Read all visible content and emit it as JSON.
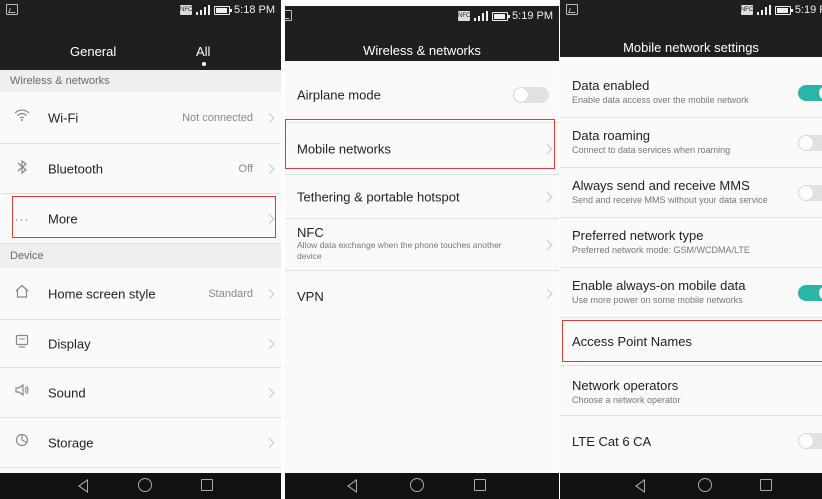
{
  "left_screen": {
    "status_time": "5:18 PM",
    "tabs": [
      {
        "label": "General"
      },
      {
        "label": "All"
      }
    ],
    "sections": [
      {
        "label": "Wireless & networks"
      },
      {
        "label": "Device"
      }
    ],
    "items": [
      {
        "label": "Wi-Fi",
        "value": "Not connected",
        "icon": "wifi-icon"
      },
      {
        "label": "Bluetooth",
        "value": "Off",
        "icon": "bluetooth-icon"
      },
      {
        "label": "More",
        "value": "",
        "icon": "more-icon"
      },
      {
        "label": "Home screen style",
        "value": "Standard",
        "icon": "home-icon"
      },
      {
        "label": "Display",
        "value": "",
        "icon": "display-icon"
      },
      {
        "label": "Sound",
        "value": "",
        "icon": "sound-icon"
      },
      {
        "label": "Storage",
        "value": "",
        "icon": "storage-icon"
      }
    ]
  },
  "middle_screen": {
    "status_time": "5:19 PM",
    "title": "Wireless & networks",
    "items": [
      {
        "label": "Airplane mode",
        "toggle": false
      },
      {
        "label": "Mobile networks"
      },
      {
        "label": "Tethering & portable hotspot"
      },
      {
        "label": "NFC",
        "subtitle": "Allow data exchange when the phone touches another device"
      },
      {
        "label": "VPN"
      }
    ]
  },
  "right_screen": {
    "status_time": "5:19 F",
    "title": "Mobile network settings",
    "items": [
      {
        "label": "Data enabled",
        "subtitle": "Enable data access over the mobile network",
        "toggle": true
      },
      {
        "label": "Data roaming",
        "subtitle": "Connect to data services when roaming",
        "toggle": false
      },
      {
        "label": "Always send and receive MMS",
        "subtitle": "Send and receive MMS without your data service",
        "toggle": false
      },
      {
        "label": "Preferred network type",
        "subtitle": "Preferred network mode: GSM/WCDMA/LTE"
      },
      {
        "label": "Enable always-on mobile data",
        "subtitle": "Use more power on some mobile networks",
        "toggle": true
      },
      {
        "label": "Access Point Names",
        "subtitle": ""
      },
      {
        "label": "Network operators",
        "subtitle": "Choose a network operator"
      },
      {
        "label": "LTE Cat 6 CA",
        "subtitle": "",
        "toggle": false
      }
    ]
  },
  "colors": {
    "toggle_on": "#2bb5a8",
    "highlight": "#d83c3c",
    "header": "#1f1f1f"
  }
}
